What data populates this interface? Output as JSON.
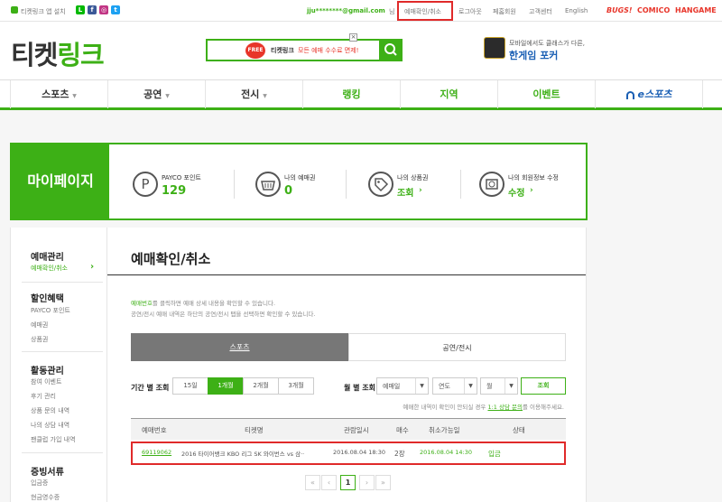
{
  "topbar": {
    "app_install": "티켓링크 앱 설치",
    "user_email": "jju********@gmail.com",
    "user_suffix": "님",
    "links": [
      "예매확인/취소",
      "로그아웃",
      "페홈회원",
      "고객센터",
      "English"
    ],
    "brands": [
      "BUGS!",
      "COMICO",
      "HANGAME"
    ]
  },
  "header": {
    "logo_part1": "티켓",
    "logo_part2": "링크",
    "search_badge": "FREE",
    "search_promo_text1": "티켓링크",
    "search_promo_text2": "모든 예매 수수료 면제!",
    "promo_top": "모바일에서도 클래스가 다른,",
    "promo_bottom": "한게임 포커"
  },
  "gnb": {
    "items": [
      "스포츠",
      "공연",
      "전시",
      "랭킹",
      "지역",
      "이벤트",
      "e스포츠"
    ]
  },
  "mypage": {
    "title": "마이페이지",
    "stats": [
      {
        "label": "PAYCO 포인트",
        "value": "129"
      },
      {
        "label": "나의 예매권",
        "value": "0"
      },
      {
        "label": "나의 상품권",
        "value": "조회"
      },
      {
        "label": "나의 회원정보 수정",
        "value": "수정"
      }
    ]
  },
  "sidebar": {
    "sections": [
      {
        "title": "예매관리",
        "items": [
          "예매확인/취소"
        ]
      },
      {
        "title": "할인혜택",
        "items": [
          "PAYCO 포인트",
          "예매권",
          "상품권"
        ]
      },
      {
        "title": "활동관리",
        "items": [
          "참여 이벤트",
          "후기 관리",
          "상품 문의 내역",
          "나의 상담 내역",
          "팬클럽 가입 내역"
        ]
      },
      {
        "title": "증빙서류",
        "items": [
          "입금증",
          "현금영수증"
        ]
      }
    ]
  },
  "main": {
    "title": "예매확인/취소",
    "note1_link": "예매번호",
    "note1_rest": "를 클릭하면 예매 상세 내용을 확인할 수 있습니다.",
    "note2": "공연/전시 예매 내역은 하단의 공연/전시 탭을 선택하면 확인할 수 있습니다.",
    "tabs": [
      "스포츠",
      "공연/전시"
    ],
    "period_label": "기간 별 조회",
    "periods": [
      "15일",
      "1개월",
      "2개월",
      "3개월"
    ],
    "month_label": "월 별 조회",
    "selects": [
      "예매일",
      "연도",
      "월"
    ],
    "search_button": "조회",
    "hint_pre": "예매한 내역이 확인이 안되실 경우",
    "hint_link": "1:1 상담 문의",
    "hint_post": "를 이용해주세요.",
    "columns": [
      "예매번호",
      "티켓명",
      "관람일시",
      "매수",
      "취소가능일",
      "상태"
    ],
    "rows": [
      {
        "number": "69119062",
        "ticket": "2016 타이어뱅크 KBO 리그 SK 와이번스 vs 삼··",
        "date": "2016.08.04 18:30",
        "count": "2장",
        "cancel": "2016.08.04 14:30",
        "status": "입금"
      }
    ],
    "pagination": {
      "current": "1"
    }
  },
  "colors": {
    "accent": "#3db016",
    "highlight": "#e02a2a"
  }
}
